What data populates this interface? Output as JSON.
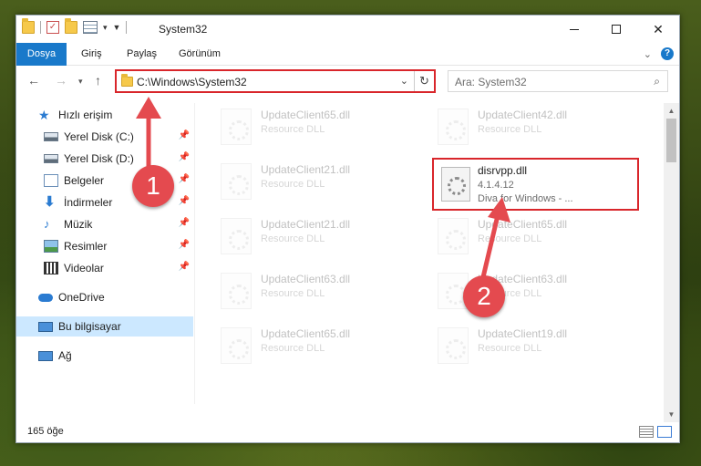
{
  "window": {
    "title": "System32",
    "controls": {
      "minimize": "minimize",
      "maximize": "maximize",
      "close": "✕"
    }
  },
  "ribbon": {
    "tabs": [
      {
        "label": "Dosya",
        "active": true
      },
      {
        "label": "Giriş"
      },
      {
        "label": "Paylaş"
      },
      {
        "label": "Görünüm"
      }
    ]
  },
  "address": {
    "path": "C:\\Windows\\System32",
    "refresh_icon": "↻"
  },
  "search": {
    "placeholder": "Ara: System32"
  },
  "sidebar": {
    "items": [
      {
        "label": "Hızlı erişim",
        "icon": "star-icon"
      },
      {
        "label": "Yerel Disk (C:)",
        "icon": "drive-icon",
        "pinned": true
      },
      {
        "label": "Yerel Disk (D:)",
        "icon": "drive-icon",
        "pinned": true
      },
      {
        "label": "Belgeler",
        "icon": "documents-icon",
        "pinned": true
      },
      {
        "label": "İndirmeler",
        "icon": "download-icon",
        "pinned": true
      },
      {
        "label": "Müzik",
        "icon": "music-icon",
        "pinned": true
      },
      {
        "label": "Resimler",
        "icon": "pictures-icon",
        "pinned": true
      },
      {
        "label": "Videolar",
        "icon": "videos-icon",
        "pinned": true
      },
      {
        "label": "OneDrive",
        "icon": "onedrive-icon"
      },
      {
        "label": "Bu bilgisayar",
        "icon": "this-pc-icon",
        "selected": true
      },
      {
        "label": "Ağ",
        "icon": "network-icon"
      }
    ]
  },
  "files": [
    {
      "name": "UpdateClient65.dll",
      "desc": "Resource DLL"
    },
    {
      "name": "UpdateClient42.dll",
      "desc": "Resource DLL"
    },
    {
      "name": "UpdateClient21.dll",
      "desc": "Resource DLL"
    },
    {
      "name": "UpdateClient21.dll",
      "desc": "Resource DLL"
    },
    {
      "name": "UpdateClient65.dll",
      "desc": "Resource DLL"
    },
    {
      "name": "UpdateClient63.dll",
      "desc": "Resource DLL"
    },
    {
      "name": "UpdateClient63.dll",
      "desc": "Resource DLL"
    },
    {
      "name": "UpdateClient65.dll",
      "desc": "Resource DLL"
    },
    {
      "name": "UpdateClient19.dll",
      "desc": "Resource DLL"
    }
  ],
  "highlighted_file": {
    "name": "disrvpp.dll",
    "version": "4.1.4.12",
    "desc": "Diva for Windows - ..."
  },
  "status": {
    "count": "165 öğe"
  },
  "annotations": {
    "callout_1": "1",
    "callout_2": "2",
    "color": "#e44a4f"
  },
  "colors": {
    "accent": "#1979ca",
    "highlight_border": "#d9262b",
    "selection": "#cce8ff"
  }
}
